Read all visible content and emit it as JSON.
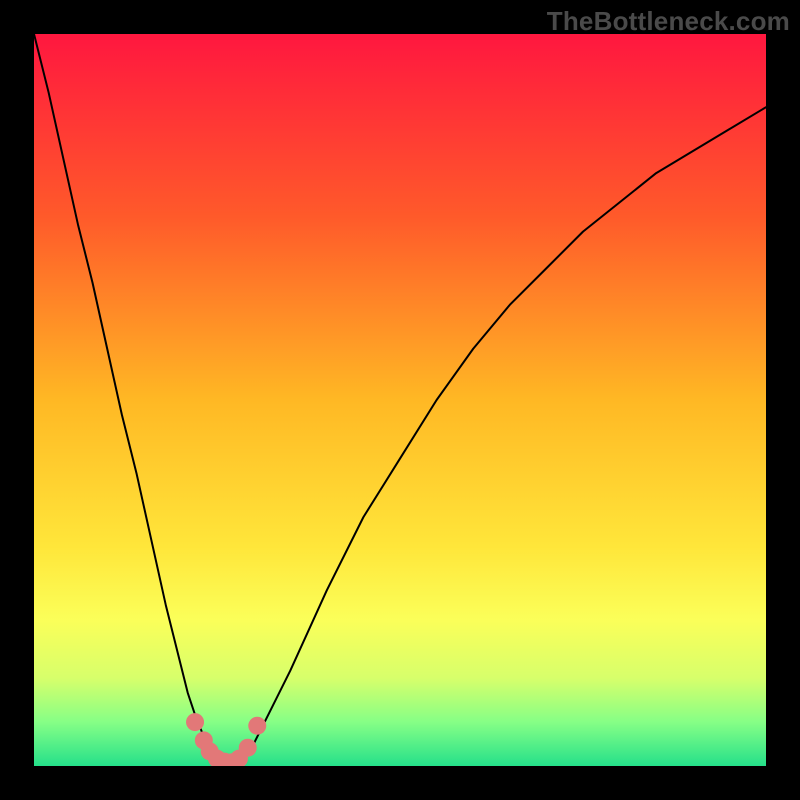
{
  "watermark": "TheBottleneck.com",
  "chart_data": {
    "type": "line",
    "title": "",
    "xlabel": "",
    "ylabel": "",
    "xlim": [
      0,
      100
    ],
    "ylim": [
      0,
      100
    ],
    "background_gradient": {
      "stops": [
        {
          "offset": 0.0,
          "color": "#ff173f"
        },
        {
          "offset": 0.25,
          "color": "#ff5a2a"
        },
        {
          "offset": 0.5,
          "color": "#ffb824"
        },
        {
          "offset": 0.7,
          "color": "#ffe63a"
        },
        {
          "offset": 0.8,
          "color": "#fbff59"
        },
        {
          "offset": 0.88,
          "color": "#d7ff6b"
        },
        {
          "offset": 0.94,
          "color": "#86ff86"
        },
        {
          "offset": 1.0,
          "color": "#25e08a"
        }
      ]
    },
    "series": [
      {
        "name": "bottleneck-curve",
        "color": "#000000",
        "stroke_width": 2,
        "x": [
          0,
          2,
          4,
          6,
          8,
          10,
          12,
          14,
          16,
          18,
          20,
          21,
          22,
          23,
          24,
          25,
          26,
          27,
          28,
          29,
          30,
          32,
          35,
          40,
          45,
          50,
          55,
          60,
          65,
          70,
          75,
          80,
          85,
          90,
          95,
          100
        ],
        "y": [
          100,
          92,
          83,
          74,
          66,
          57,
          48,
          40,
          31,
          22,
          14,
          10,
          7,
          4.5,
          2.5,
          1.2,
          0.6,
          0.3,
          0.6,
          1.5,
          3,
          7,
          13,
          24,
          34,
          42,
          50,
          57,
          63,
          68,
          73,
          77,
          81,
          84,
          87,
          90
        ]
      },
      {
        "name": "optimal-markers",
        "type": "scatter",
        "color": "#e27878",
        "radius": 9,
        "x": [
          22.0,
          23.2,
          24.0,
          25.0,
          26.0,
          27.0,
          28.0,
          29.2,
          30.5
        ],
        "y": [
          6.0,
          3.5,
          2.0,
          1.0,
          0.6,
          0.5,
          1.0,
          2.5,
          5.5
        ]
      }
    ]
  }
}
